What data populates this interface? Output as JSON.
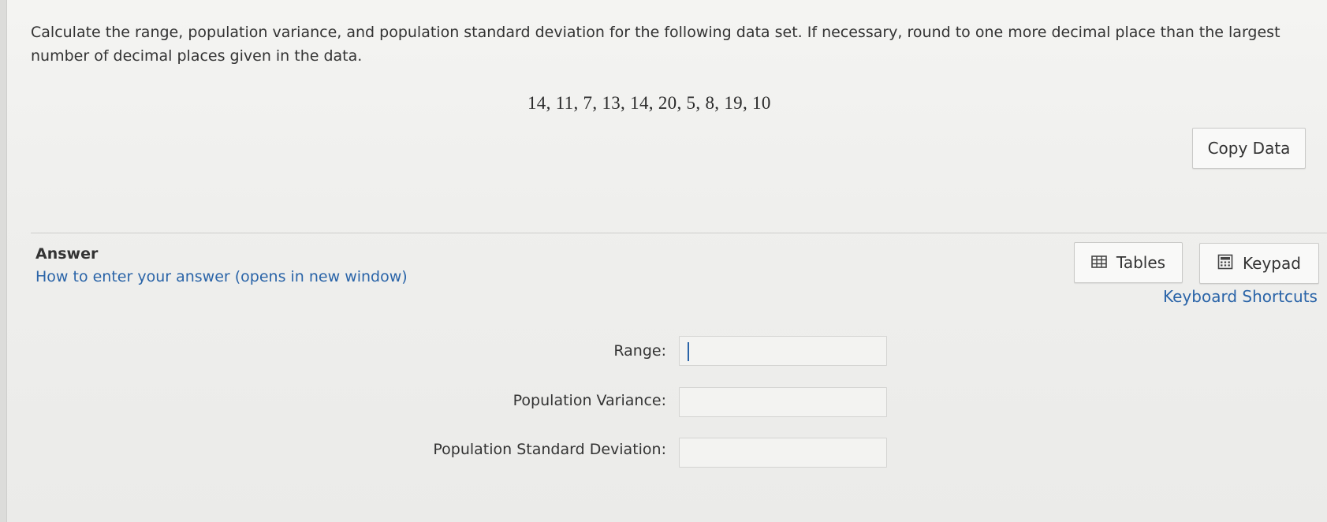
{
  "question": {
    "text": "Calculate the range, population variance, and population standard deviation for the following data set. If necessary, round to one more decimal place than the largest number of decimal places given in the data.",
    "dataset": "14, 11, 7, 13, 14, 20, 5, 8, 19, 10",
    "copy_button_label": "Copy Data"
  },
  "answer": {
    "heading": "Answer",
    "help_link": "How to enter your answer (opens in new window)",
    "tables_label": "Tables",
    "keypad_label": "Keypad",
    "shortcuts_link": "Keyboard Shortcuts",
    "fields": [
      {
        "label": "Range:",
        "value": ""
      },
      {
        "label": "Population Variance:",
        "value": ""
      },
      {
        "label": "Population Standard Deviation:",
        "value": ""
      }
    ]
  },
  "icons": {
    "tables": "table-grid-icon",
    "keypad": "calculator-keypad-icon"
  },
  "colors": {
    "link": "#2a64a8",
    "caret": "#2a64a8"
  }
}
